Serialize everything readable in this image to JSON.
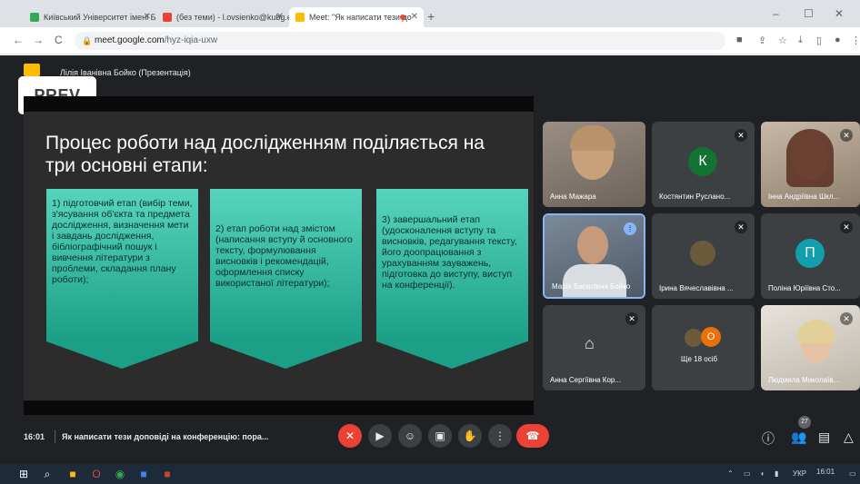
{
  "browser": {
    "tabs": [
      {
        "label": "Київський Університет імені Б",
        "favicon_color": "#34a853",
        "active": false
      },
      {
        "label": "(без теми) - l.ovsienko@kubg.e",
        "favicon_color": "#ea4335",
        "active": false
      },
      {
        "label": "Meet: \"Як написати тези до",
        "favicon_color": "#fbbc04",
        "active": true
      }
    ],
    "new_tab": "+",
    "window_controls": {
      "minimize": "–",
      "maximize": "☐",
      "close": "✕"
    },
    "nav": {
      "back": "←",
      "forward": "→",
      "reload": "C"
    },
    "url_host": "meet.google.com",
    "url_path": "/hyz-iqia-uxw"
  },
  "meet": {
    "presenter_label": "Лілія Іванівна Бойко (Презентація)",
    "prev_button": "PREV",
    "slide": {
      "title": "Процес роботи над дослідженням поділяється на три основні етапи:",
      "stages": [
        "1) підготовчий етап (вибір теми, з'ясування об'єкта та предмета дослідження, визначення мети і завдань дослідження, бібліографічний пошук і вивчення літератури з проблеми, складання плану роботи);",
        "2) етап роботи над змістом (написання вступу й основного тексту, формулювання висновків і рекомендацій, оформлення списку використаної літератури);",
        "3) завершальний етап (удосконалення вступу та висновків, редагування тексту, його доопрацювання з урахуванням зауважень, підготовка до виступу, виступ на конференції)."
      ]
    },
    "participants": [
      {
        "name": "Анна Мажара",
        "type": "photo"
      },
      {
        "name": "Костянтин Руслано...",
        "type": "avatar",
        "initial": "К",
        "color": "#137333"
      },
      {
        "name": "Інна Андріївна Шкл...",
        "type": "photo"
      },
      {
        "name": "Марія Василівна Бойко",
        "type": "photo",
        "speaking": true
      },
      {
        "name": "Ірина Вячеславівна ...",
        "type": "photo-small"
      },
      {
        "name": "Поліна Юріївна Сто...",
        "type": "avatar",
        "initial": "П",
        "color": "#129eaf"
      },
      {
        "name": "Анна Сергіївна Кор...",
        "type": "icon"
      },
      {
        "name": "Ще 18 осіб",
        "type": "more",
        "initial": "О"
      },
      {
        "name": "Людмила Миколаїв...",
        "type": "photo"
      }
    ],
    "controls": {
      "time": "16:01",
      "meeting_title": "Як написати тези доповіді на конференцію: пора...",
      "people_count": "27"
    }
  },
  "taskbar": {
    "language": "УКР",
    "clock_time": "16:01"
  }
}
